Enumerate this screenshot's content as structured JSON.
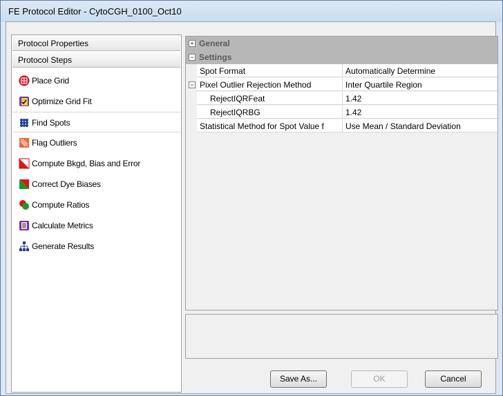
{
  "window": {
    "title": "FE Protocol Editor - CytoCGH_0100_Oct10"
  },
  "left_panel": {
    "headers": [
      "Protocol Properties",
      "Protocol Steps"
    ],
    "steps": [
      {
        "label": "Place Grid",
        "icon": "place-grid-icon"
      },
      {
        "label": "Optimize Grid Fit",
        "icon": "optimize-grid-fit-icon"
      },
      {
        "label": "Find Spots",
        "icon": "find-spots-icon",
        "selected": true
      },
      {
        "label": "Flag Outliers",
        "icon": "flag-outliers-icon"
      },
      {
        "label": "Compute Bkgd, Bias and Error",
        "icon": "compute-bkgd-icon"
      },
      {
        "label": "Correct Dye Biases",
        "icon": "correct-dye-biases-icon"
      },
      {
        "label": "Compute Ratios",
        "icon": "compute-ratios-icon"
      },
      {
        "label": "Calculate Metrics",
        "icon": "calculate-metrics-icon"
      },
      {
        "label": "Generate Results",
        "icon": "generate-results-icon"
      }
    ]
  },
  "property_grid": {
    "categories": [
      {
        "label": "General",
        "toggle": "+"
      },
      {
        "label": "Settings",
        "toggle": "−"
      }
    ],
    "rows": [
      {
        "name": "Spot Format",
        "value": "Automatically Determine"
      },
      {
        "name": "Pixel Outlier Rejection Method",
        "value": "Inter Quartile Region",
        "toggle": "−"
      },
      {
        "name": "RejectIQRFeat",
        "value": "1.42",
        "sub": true
      },
      {
        "name": "RejectIQRBG",
        "value": "1.42",
        "sub": true
      },
      {
        "name": "Statistical Method for Spot Value f",
        "value": "Use Mean / Standard Deviation"
      }
    ]
  },
  "buttons": {
    "save_as": "Save As...",
    "ok": "OK",
    "cancel": "Cancel"
  }
}
